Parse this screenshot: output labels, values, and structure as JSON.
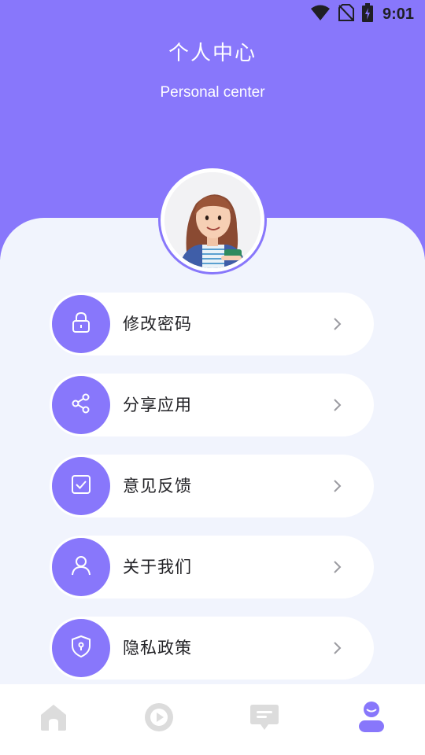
{
  "status_bar": {
    "time": "9:01",
    "icons": [
      "wifi-icon",
      "no-sim-icon",
      "battery-charging-icon"
    ]
  },
  "header": {
    "title": "个人中心",
    "subtitle": "Personal center"
  },
  "avatar": {
    "icon": "user-avatar-illustration"
  },
  "menu": {
    "items": [
      {
        "label": "修改密码",
        "icon": "lock-icon"
      },
      {
        "label": "分享应用",
        "icon": "share-icon"
      },
      {
        "label": "意见反馈",
        "icon": "feedback-check-icon"
      },
      {
        "label": "关于我们",
        "icon": "person-icon"
      },
      {
        "label": "隐私政策",
        "icon": "shield-icon"
      }
    ]
  },
  "tab_bar": {
    "tabs": [
      {
        "icon": "home-icon",
        "active": false
      },
      {
        "icon": "play-icon",
        "active": false
      },
      {
        "icon": "message-icon",
        "active": false
      },
      {
        "icon": "profile-icon",
        "active": true
      }
    ]
  },
  "colors": {
    "accent": "#8877fb",
    "background": "#f1f4fd",
    "inactive_icon": "#dcdcdc"
  }
}
